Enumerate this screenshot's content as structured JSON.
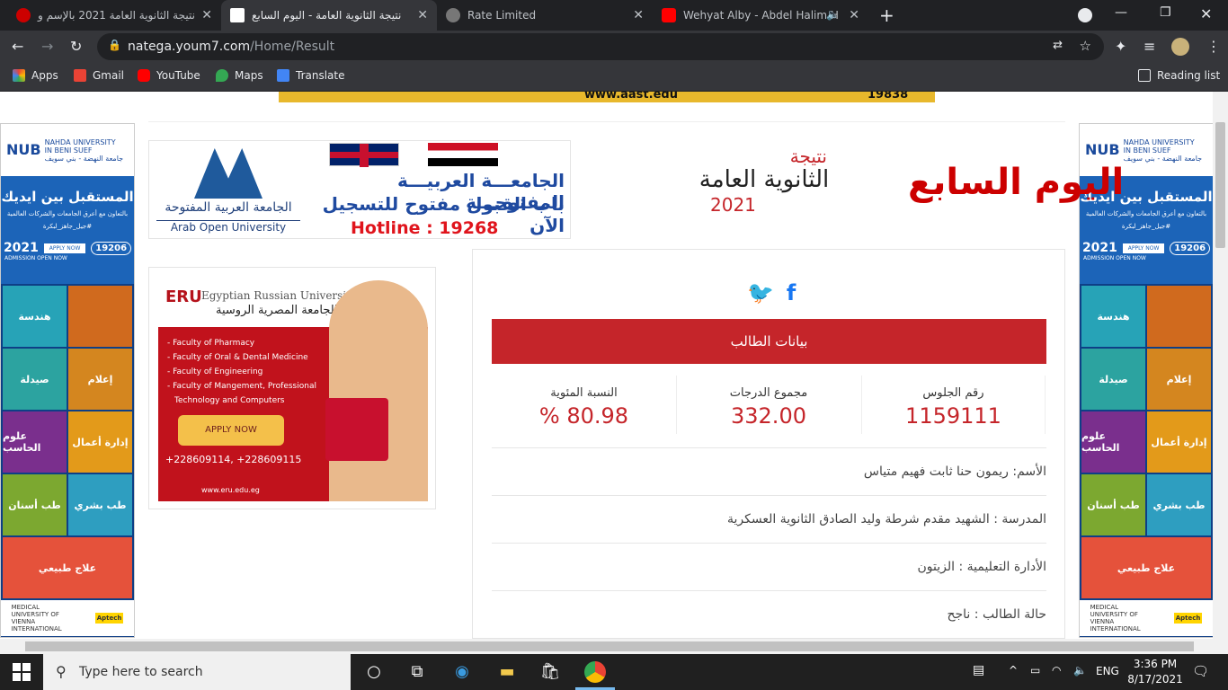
{
  "browser": {
    "tabs": [
      {
        "title": "نتيجة الثانوية العامة 2021 بالإسم و",
        "active": false
      },
      {
        "title": "نتيجة الثانوية العامة - اليوم السابع",
        "active": true
      },
      {
        "title": "Rate Limited",
        "active": false
      },
      {
        "title": "Wehyat Alby - Abdel Halim H",
        "active": false
      }
    ],
    "new_tab_label": "+",
    "url_domain": "natega.youm7.com",
    "url_path": "/Home/Result",
    "bookmarks": [
      "Apps",
      "Gmail",
      "YouTube",
      "Maps",
      "Translate"
    ],
    "reading_list": "Reading list"
  },
  "ads": {
    "side": {
      "brand": "NUB",
      "name_line1": "NAHDA UNIVERSITY",
      "name_line2": "IN BENI SUEF",
      "name_ar": "جامعة النهضة - بني سويف",
      "headline": "المستقبل بين ايديك",
      "sub": "بالتعاون مع أعرق الجامعات والشركات العالمية",
      "hashtag": "#جيل_جاهز_لبكرة",
      "apply": "APPLY NOW",
      "year": "2021",
      "admission": "ADMISSION OPEN NOW",
      "hotline": "19206",
      "cells": [
        "هندسة",
        "",
        "صيدلة",
        "إعلام",
        "علوم الحاسب",
        "إدارة أعمال",
        "طب أسنان",
        "طب بشري",
        "علاج طبيعي",
        ""
      ],
      "logo1": "MEDICAL UNIVERSITY OF VIENNA INTERNATIONAL",
      "logo2": "Aptech"
    },
    "aou": {
      "name_ar_1": "الجامعـــة العربيـــة المفتوحـــة",
      "name_ar_2": "باب القبول مفتوح للتسجيل الآن",
      "hotline": "Hotline : 19268",
      "logo_ar": "الجامعة العربية المفتوحة",
      "logo_en": "Arab Open University"
    },
    "eru": {
      "name_en": "Egyptian Russian University",
      "name_ar": "الجامعة المصرية الروسية",
      "abbr": "ERU",
      "faculties": [
        "- Faculty of  Pharmacy",
        "- Faculty of Oral & Dental Medicine",
        "- Faculty of Engineering",
        "- Faculty of Mangement, Professional",
        "  Technology and Computers"
      ],
      "apply": "APPLY NOW",
      "phones": "+228609114,  +228609115",
      "site": "www.eru.edu.eg"
    },
    "top_banner_text": "www.aast.edu",
    "top_banner_num": "19838"
  },
  "header": {
    "site_logo": "اليوم السابع",
    "result_word": "نتيجة",
    "result_title": "الثانوية العامة",
    "result_year": "2021"
  },
  "result": {
    "section_title": "بيانات الطالب",
    "seat_label": "رقم الجلوس",
    "seat_value": "1159111",
    "total_label": "مجموع الدرجات",
    "total_value": "332.00",
    "percent_label": "النسبة المئوية",
    "percent_value": "% 80.98",
    "rows": [
      "الأسم: ريمون حنا ثابت فهيم متياس",
      "المدرسة : الشهيد مقدم شرطة وليد الصادق الثانوية العسكرية",
      "الأدارة التعليمية : الزيتون",
      "حالة الطالب : ناجح"
    ]
  },
  "taskbar": {
    "search_placeholder": "Type here to search",
    "lang": "ENG",
    "time": "3:36 PM",
    "date": "8/17/2021"
  },
  "colors": {
    "accent_red": "#c5252a",
    "brand_blue": "#1c64b8"
  }
}
